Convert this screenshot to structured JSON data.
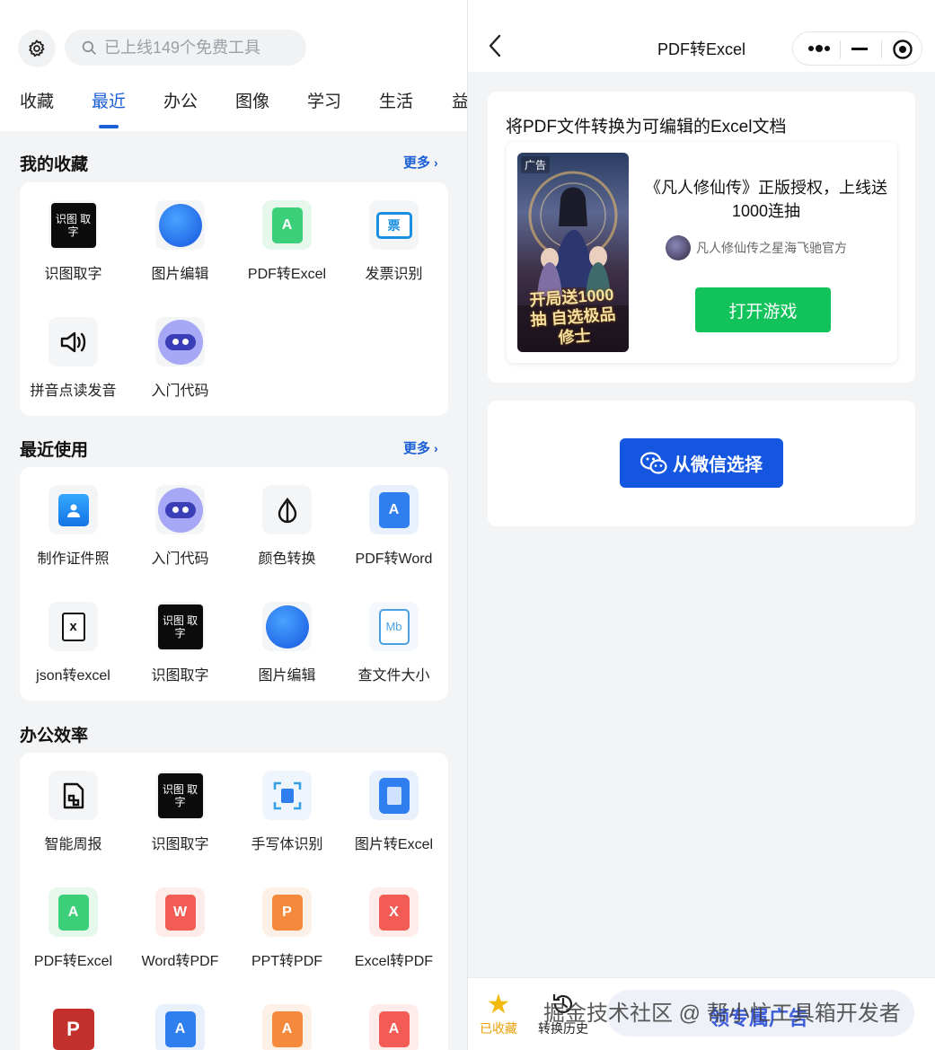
{
  "left": {
    "search": {
      "placeholder": "已上线149个免费工具"
    },
    "tabs": [
      "收藏",
      "最近",
      "办公",
      "图像",
      "学习",
      "生活",
      "益"
    ],
    "active_tab": "最近",
    "favorites": {
      "title": "我的收藏",
      "more": "更多",
      "items": [
        {
          "label": "识图取字",
          "icon": "ocr-text-icon",
          "icon_text": "识图 取字"
        },
        {
          "label": "图片编辑",
          "icon": "image-edit-icon"
        },
        {
          "label": "PDF转Excel",
          "icon": "pdf-to-excel-icon"
        },
        {
          "label": "发票识别",
          "icon": "invoice-icon",
          "icon_text": "票"
        },
        {
          "label": "拼音点读发音",
          "icon": "speaker-icon"
        },
        {
          "label": "入门代码",
          "icon": "robot-icon"
        }
      ]
    },
    "recent": {
      "title": "最近使用",
      "more": "更多",
      "items": [
        {
          "label": "制作证件照",
          "icon": "id-photo-icon"
        },
        {
          "label": "入门代码",
          "icon": "robot-icon"
        },
        {
          "label": "颜色转换",
          "icon": "color-drop-icon"
        },
        {
          "label": "PDF转Word",
          "icon": "pdf-to-word-icon"
        },
        {
          "label": "json转excel",
          "icon": "json-excel-icon"
        },
        {
          "label": "识图取字",
          "icon": "ocr-text-icon",
          "icon_text": "识图 取字"
        },
        {
          "label": "图片编辑",
          "icon": "image-edit-icon"
        },
        {
          "label": "查文件大小",
          "icon": "file-size-icon",
          "icon_text": "Mb"
        }
      ]
    },
    "office": {
      "title": "办公效率",
      "items": [
        {
          "label": "智能周报",
          "icon": "weekly-report-icon"
        },
        {
          "label": "识图取字",
          "icon": "ocr-text-icon",
          "icon_text": "识图 取字"
        },
        {
          "label": "手写体识别",
          "icon": "handwriting-icon"
        },
        {
          "label": "图片转Excel",
          "icon": "image-to-excel-icon"
        },
        {
          "label": "PDF转Excel",
          "icon": "pdf-to-excel-icon"
        },
        {
          "label": "Word转PDF",
          "icon": "word-to-pdf-icon"
        },
        {
          "label": "PPT转PDF",
          "icon": "ppt-to-pdf-icon"
        },
        {
          "label": "Excel转PDF",
          "icon": "excel-to-pdf-icon"
        }
      ]
    }
  },
  "right": {
    "nav": {
      "title": "PDF转Excel"
    },
    "panel1": {
      "heading": "将PDF文件转换为可编辑的Excel文档",
      "ad": {
        "tag": "广告",
        "poster_text": "开局送1000抽 自选极品修士",
        "headline": "《凡人修仙传》正版授权，上线送1000连抽",
        "source": "凡人修仙传之星海飞驰官方",
        "cta": "打开游戏"
      }
    },
    "panel2": {
      "button": "从微信选择"
    },
    "bottombar": {
      "fav_label": "已收藏",
      "history_label": "转换历史",
      "pill_text": "领专属广告"
    },
    "watermark": "掘金技术社区 @ 帮小忙工具箱开发者"
  },
  "colors": {
    "accent": "#1a5fd6",
    "cta_green": "#12c35c",
    "button_blue": "#1556e0",
    "star": "#f2b90f"
  }
}
